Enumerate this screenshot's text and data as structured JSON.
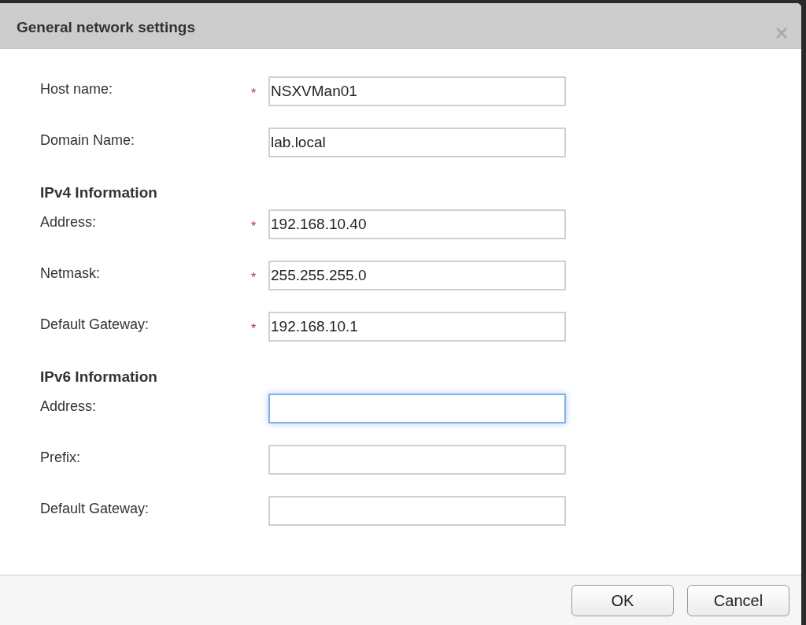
{
  "dialog": {
    "title": "General network settings"
  },
  "items": [
    {
      "kind": "field",
      "label": "Host name:",
      "required_mark": "*",
      "value": "NSXVMan01",
      "focused": false
    },
    {
      "kind": "field",
      "label": "Domain Name:",
      "value": "lab.local",
      "focused": false
    },
    {
      "kind": "section",
      "label": "IPv4 Information"
    },
    {
      "kind": "field",
      "label": "Address:",
      "required_mark": "*",
      "value": "192.168.10.40",
      "focused": false
    },
    {
      "kind": "field",
      "label": "Netmask:",
      "required_mark": "*",
      "value": "255.255.255.0",
      "focused": false
    },
    {
      "kind": "field",
      "label": "Default Gateway:",
      "required_mark": "*",
      "value": "192.168.10.1",
      "focused": false
    },
    {
      "kind": "section",
      "label": "IPv6 Information"
    },
    {
      "kind": "field",
      "label": "Address:",
      "value": "",
      "focused": true
    },
    {
      "kind": "field",
      "label": "Prefix:",
      "value": "",
      "focused": false
    },
    {
      "kind": "field",
      "label": "Default Gateway:",
      "value": "",
      "focused": false
    }
  ],
  "buttons": [
    "OK",
    "Cancel"
  ]
}
